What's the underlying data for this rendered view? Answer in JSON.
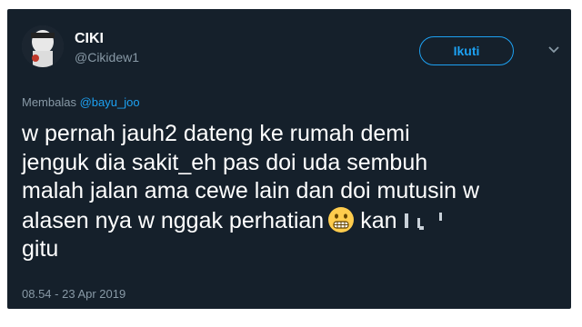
{
  "tweet": {
    "author": {
      "display_name": "CIKI",
      "handle": "@Cikidew1"
    },
    "follow_label": "Ikuti",
    "reply_prefix": "Membalas",
    "reply_mention": "@bayu_joo",
    "text_lines": [
      "w pernah jauh2 dateng ke rumah demi",
      "jenguk dia sakit_eh pas doi uda sembuh",
      "malah jalan ama cewe lain dan doi mutusin w",
      "alasen nya w nggak perhatian",
      "gitu"
    ],
    "after_emoji_text": "kan",
    "emoji": "grimacing-face",
    "timestamp": "08.54 - 23 Apr 2019"
  },
  "colors": {
    "background": "#15202b",
    "accent": "#1da1f2",
    "text_primary": "#ffffff",
    "text_secondary": "#8899a6"
  }
}
